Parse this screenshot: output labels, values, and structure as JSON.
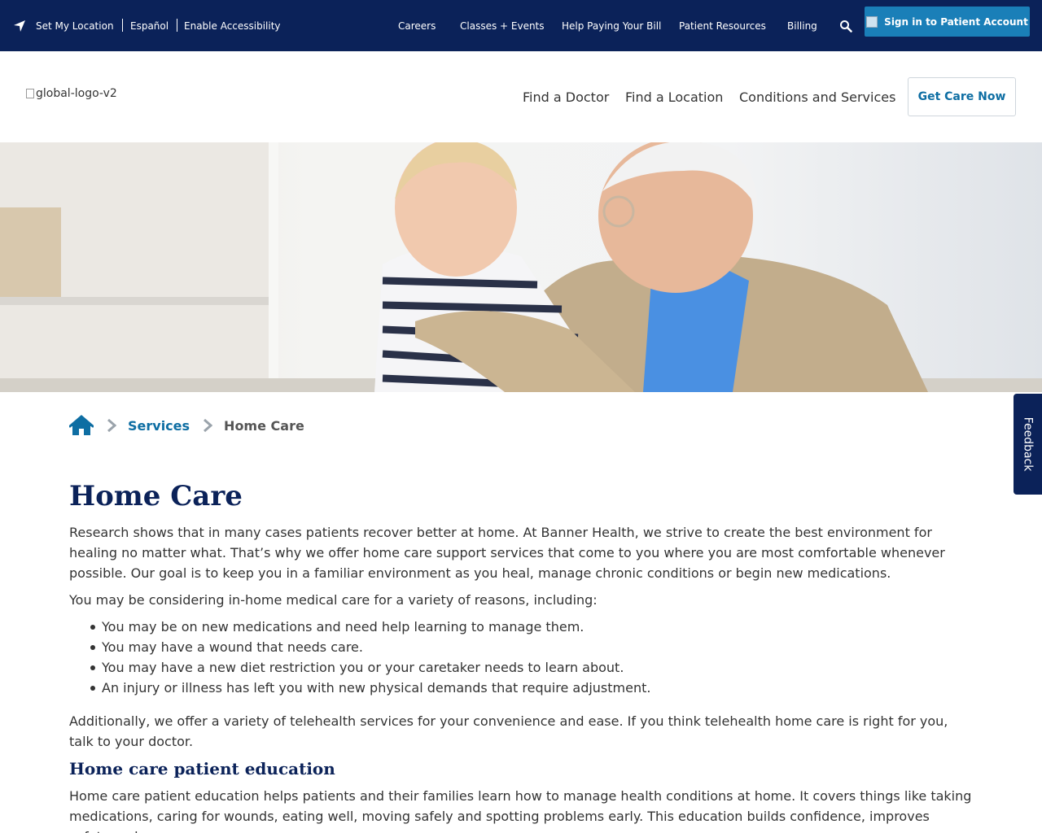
{
  "topbar": {
    "set_location": "Set My Location",
    "espanol": "Español",
    "accessibility": "Enable Accessibility",
    "nav": [
      "Careers",
      "Classes + Events",
      "Help Paying Your Bill",
      "Patient Resources",
      "Billing"
    ],
    "signin": "Sign in to Patient Account"
  },
  "header": {
    "logo_alt": "global-logo-v2",
    "nav": [
      "Find a Doctor",
      "Find a Location",
      "Conditions and Services"
    ],
    "cta": "Get Care Now"
  },
  "feedback": "Feedback",
  "breadcrumb": {
    "services": "Services",
    "current": "Home Care"
  },
  "content": {
    "title": "Home Care",
    "intro": "Research shows that in many cases patients recover better at home. At Banner Health, we strive to create the best environment for healing no matter what. That’s why we offer home care support services that come to you where you are most comfortable whenever possible. Our goal is to keep you in a familiar environment as you heal, manage chronic conditions or begin new medications.",
    "lead": "You may be considering in-home medical care for a variety of reasons, including:",
    "reasons": [
      "You may be on new medications and need help learning to manage them.",
      "You may have a wound that needs care.",
      "You may have a new diet restriction you or your caretaker needs to learn about.",
      "An injury or illness has left you with new physical demands that require adjustment."
    ],
    "telehealth": "Additionally, we offer a variety of telehealth services for your convenience and ease. If you think telehealth home care is right for you, talk to your doctor.",
    "education_heading": "Home care patient education",
    "education_text": "Home care patient education helps patients and their families learn how to manage health conditions at home. It covers things like taking medications, caring for wounds, eating well, moving safely and spotting problems early. This education builds confidence, improves safety and"
  },
  "colors": {
    "navy": "#0b2259",
    "link_blue": "#0e6ea3",
    "button_blue": "#1a7fb8"
  }
}
